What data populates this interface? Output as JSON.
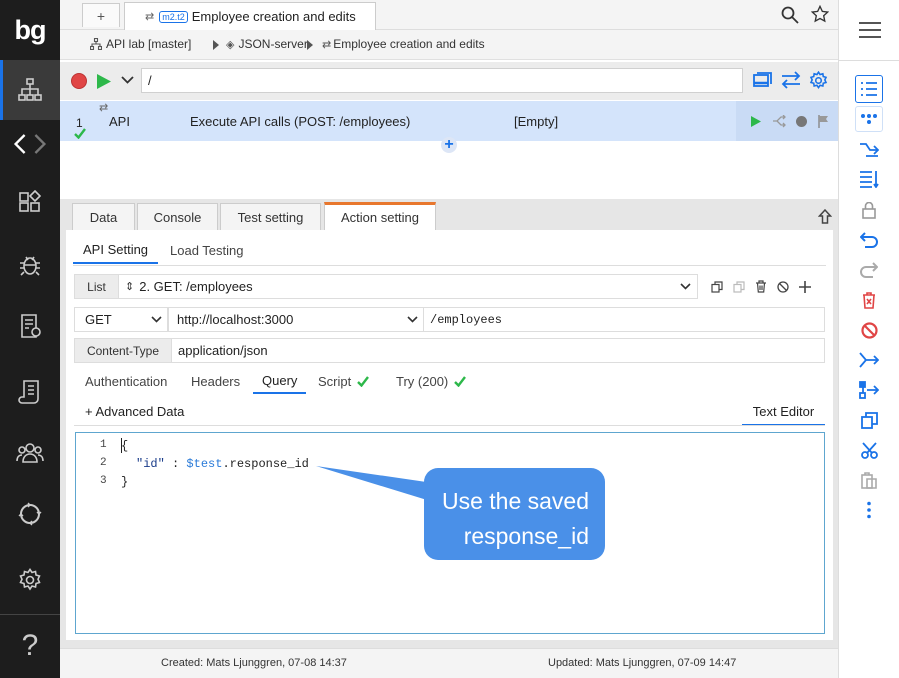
{
  "logo": "bg",
  "tabbar": {
    "new_tab_label": "+",
    "tab_badge": "m2.t2",
    "tab_title": "Employee creation and edits"
  },
  "breadcrumb": {
    "items": [
      "API lab [master]",
      "JSON-server",
      "Employee creation and edits"
    ]
  },
  "runbar": {
    "path_value": "/"
  },
  "step": {
    "number": "1",
    "type": "API",
    "description": "Execute API calls (POST: /employees)",
    "value": "[Empty]"
  },
  "panel_tabs": [
    "Data",
    "Console",
    "Test setting",
    "Action setting"
  ],
  "sub_tabs": [
    "API Setting",
    "Load Testing"
  ],
  "list": {
    "label": "List",
    "selected": "2. GET: /employees"
  },
  "request": {
    "method": "GET",
    "base_url": "http://localhost:3000",
    "path": "/employees"
  },
  "content_type": {
    "label": "Content-Type",
    "value": "application/json"
  },
  "request_tabs": [
    "Authentication",
    "Headers",
    "Query",
    "Script",
    "Try (200)"
  ],
  "advanced_data_label": "+ Advanced Data",
  "text_editor_label": "Text Editor",
  "editor": {
    "line_numbers": [
      "1",
      "2",
      "3"
    ],
    "line1": "{",
    "line2_key": "\"id\"",
    "line2_colon": " : ",
    "line2_var": "$test",
    "line2_rest": ".response_id",
    "line3": "}"
  },
  "callout": {
    "line1": "Use the saved",
    "line2": "response_id"
  },
  "footer": {
    "created": "Created: Mats Ljunggren, 07-08 14:37",
    "updated": "Updated: Mats Ljunggren, 07-09 14:47"
  },
  "colors": {
    "accent_blue": "#1a73e8",
    "orange_tab": "#e8772e",
    "green": "#2db84a",
    "red": "#e04545",
    "nav_bg": "#1d1d1d",
    "callout_bg": "#4a90e8"
  },
  "icons": {
    "left_nav": [
      "hierarchy-icon",
      "code-arrows-icon",
      "apps-icon",
      "bug-icon",
      "report-icon",
      "script-icon",
      "team-icon",
      "sync-icon",
      "settings-icon",
      "help-icon"
    ],
    "right_toolbar": [
      "menu-icon",
      "list-icon",
      "dots-icon",
      "branch-icon",
      "sort-icon",
      "lock-icon",
      "undo-icon",
      "redo-icon",
      "delete-icon",
      "disable-icon",
      "split-icon",
      "move-icon",
      "copy-icon",
      "cut-icon",
      "paste-icon",
      "more-icon"
    ]
  }
}
